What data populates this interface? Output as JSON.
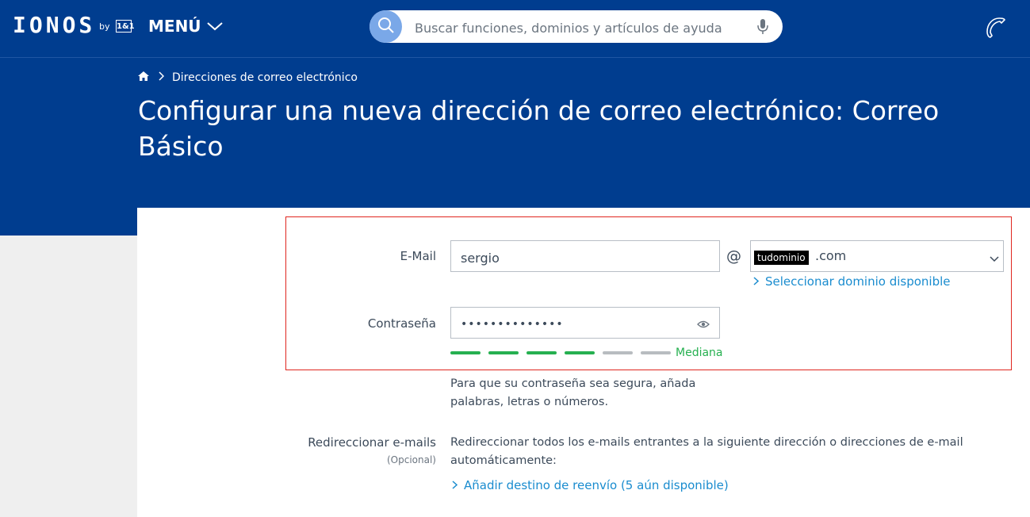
{
  "topbar": {
    "logo": "IONOS",
    "logo_by": "by",
    "logo_partner": "1&1",
    "menu_label": "MENÚ",
    "search_placeholder": "Buscar funciones, dominios y artículos de ayuda"
  },
  "breadcrumb": {
    "current": "Direcciones de correo electrónico"
  },
  "page": {
    "title": "Configurar una nueva dirección de correo electrónico: Correo Básico"
  },
  "form": {
    "email_label": "E-Mail",
    "email_value": "sergio",
    "at_sign": "@",
    "domain_value": "tudominio",
    "domain_tld": ".com",
    "select_domain_link": "Seleccionar dominio disponible",
    "password_label": "Contraseña",
    "password_value": "••••••••••••••",
    "strength": {
      "level": 4,
      "total": 6,
      "label": "Mediana"
    },
    "password_hint": "Para que su contraseña sea segura, añada palabras, letras o números.",
    "forward_label": "Redireccionar e-mails",
    "forward_optional": "(Opcional)",
    "forward_desc": "Redireccionar todos los e-mails entrantes a la siguiente dirección o direcciones de e-mail automáticamente:",
    "forward_link": "Añadir destino de reenvío (5 aún disponible)"
  },
  "colors": {
    "header_bg": "#003d8f",
    "link": "#1a8ccf",
    "strength_on": "#26b050",
    "highlight_border": "#e0261f"
  }
}
